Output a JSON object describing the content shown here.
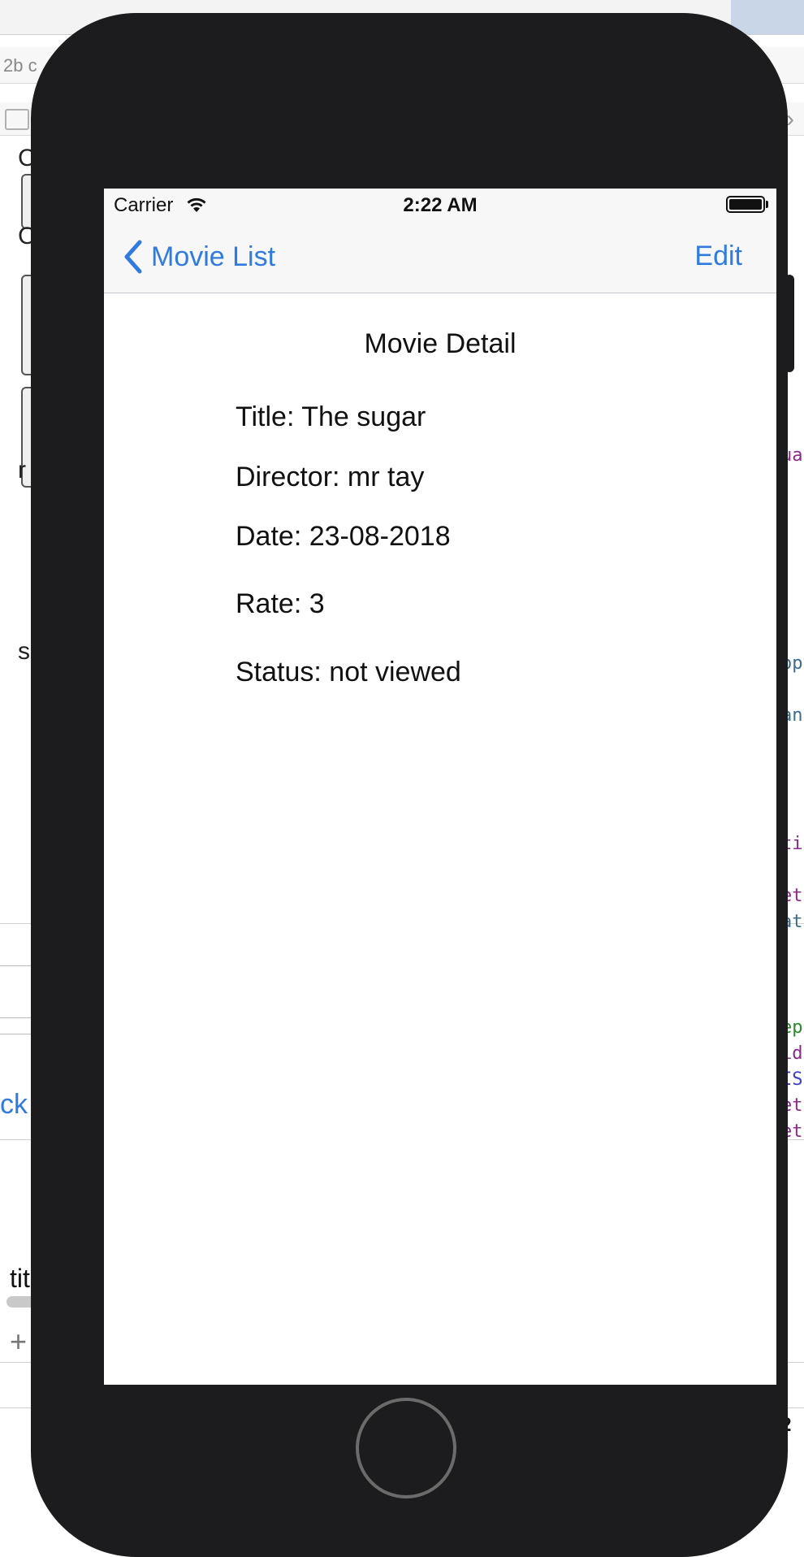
{
  "background": {
    "crumb_text": "2b c",
    "left_letters": [
      "C",
      "C",
      "r",
      "s"
    ],
    "back_partial": "ck",
    "tit_partial": "tit",
    "code_fragments": [
      {
        "text": "ua",
        "color": "#8a2a8a"
      },
      {
        "text": "op",
        "color": "#3d6d8a"
      },
      {
        "text": "an",
        "color": "#3d6d8a"
      },
      {
        "text": "ti",
        "color": "#8a2a8a"
      },
      {
        "text": "et",
        "color": "#8a2a8a"
      },
      {
        "text": "at",
        "color": "#3d6d8a"
      },
      {
        "text": "ep",
        "color": "#2c8a2c"
      },
      {
        "text": "id",
        "color": "#8a2a8a"
      },
      {
        "text": "IS",
        "color": "#3d3dcc"
      },
      {
        "text": "et",
        "color": "#8a2a8a"
      },
      {
        "text": "et",
        "color": "#8a2a8a"
      },
      {
        "text": "2",
        "color": "#111111"
      }
    ]
  },
  "status_bar": {
    "carrier": "Carrier",
    "time": "2:22 AM",
    "wifi_icon": "wifi-icon",
    "battery_icon": "battery-icon"
  },
  "nav_bar": {
    "back_label": "Movie List",
    "back_icon": "chevron-left-icon",
    "edit_label": "Edit",
    "accent_color": "#2f7bde"
  },
  "detail": {
    "heading": "Movie Detail",
    "title": "Title: The sugar",
    "director": "Director: mr tay",
    "date": "Date: 23-08-2018",
    "rate": "Rate: 3",
    "status": "Status: not viewed"
  }
}
